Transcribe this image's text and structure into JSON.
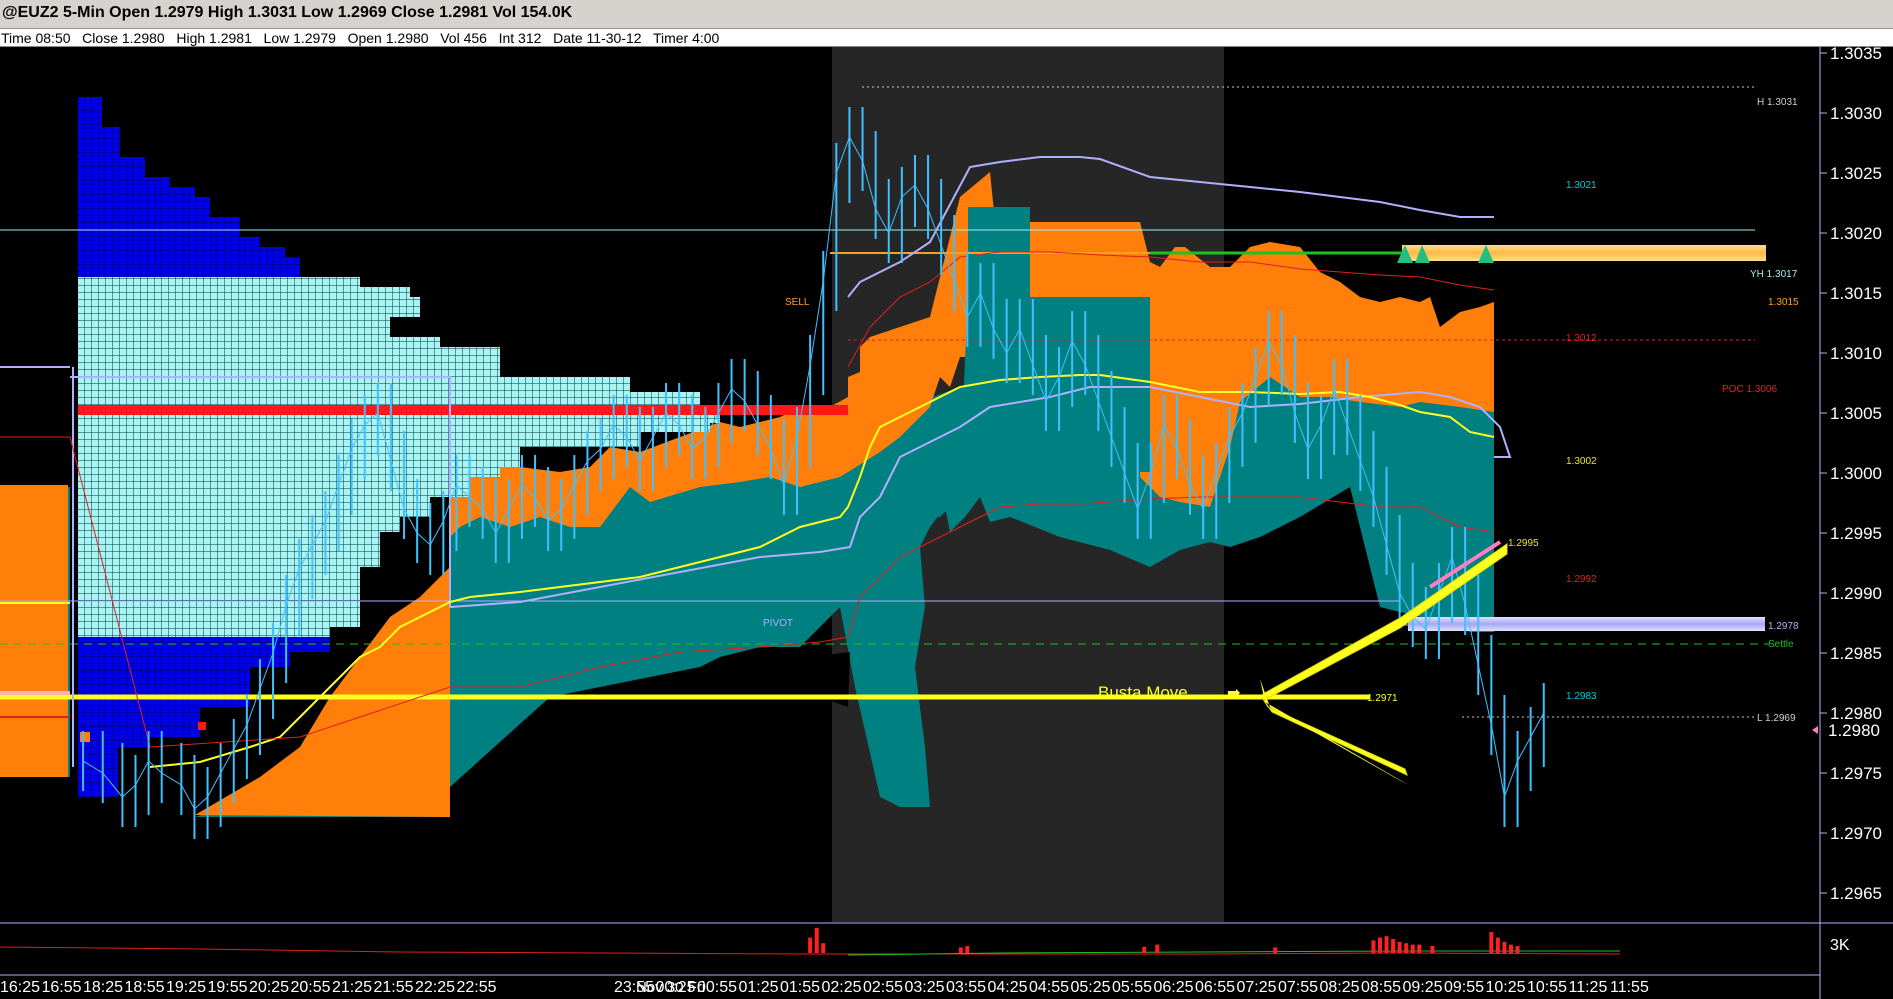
{
  "header": {
    "title": "@EUZ2 5-Min Open 1.2979 High 1.3031 Low 1.2969 Close 1.2981 Vol 154.0K",
    "info": "Time 08:50   Close 1.2980   High 1.2981   Low 1.2979   Open 1.2980   Vol 456   Int 312   Date 11-30-12   Timer 4:00"
  },
  "chart_data": {
    "type": "line",
    "symbol": "@EUZ2",
    "interval": "5-Min",
    "ylim": [
      1.29625,
      1.30355
    ],
    "y_ticks": [
      "1.3035",
      "1.3030",
      "1.3025",
      "1.3020",
      "1.3015",
      "1.3010",
      "1.3005",
      "1.3000",
      "1.2995",
      "1.2990",
      "1.2985",
      "1.2980",
      "1.2975",
      "1.2970",
      "1.2965"
    ],
    "current_price": "1.2980",
    "volume_scale_label": "3K",
    "x_time_labels": [
      "16:25",
      "16:55",
      "18:25",
      "18:55",
      "19:25",
      "19:55",
      "20:25",
      "20:55",
      "21:25",
      "21:55",
      "22:25",
      "22:55",
      "23:55",
      "00:25",
      "00:55",
      "01:25",
      "01:55",
      "02:25",
      "02:55",
      "03:25",
      "03:55",
      "04:25",
      "04:55",
      "05:25",
      "05:55",
      "06:25",
      "06:55",
      "07:25",
      "07:55",
      "08:25",
      "08:55",
      "09:25",
      "09:55",
      "10:25",
      "10:55",
      "11:25",
      "11:55"
    ],
    "date_label": "Nov 30 Fri",
    "levels": [
      {
        "label": "H 1.3031",
        "value": 1.3031
      },
      {
        "label": "YH 1.3017",
        "value": 1.3017
      },
      {
        "label": "1.3015",
        "value": 1.3015,
        "tag": "SELL"
      },
      {
        "label": "POC 1.3006",
        "value": 1.3006
      },
      {
        "label": "PIVOT",
        "value": 1.2978,
        "price_label": "1.2978"
      },
      {
        "label": "Settle",
        "value": 1.29765
      },
      {
        "label": "1.2971",
        "value": 1.2971
      },
      {
        "label": "L 1.2969",
        "value": 1.2969
      }
    ],
    "series_labels": [
      {
        "text": "1.3021",
        "value": 1.3021,
        "color": "#00d0d0"
      },
      {
        "text": "1.3012",
        "value": 1.3012,
        "color": "#e02020"
      },
      {
        "text": "1.3002",
        "value": 1.3002,
        "color": "#e8e820"
      },
      {
        "text": "1.2992",
        "value": 1.2992,
        "color": "#e02020"
      },
      {
        "text": "1.2983",
        "value": 1.2983,
        "color": "#00d0d0"
      },
      {
        "text": "1.2995",
        "value": 1.2995,
        "color": "#e8e820"
      }
    ],
    "annotation": "Busta Move",
    "price_path": [
      [
        2,
        1.2976
      ],
      [
        5,
        1.2975
      ],
      [
        8,
        1.2973
      ],
      [
        10,
        1.2974
      ],
      [
        12,
        1.2976
      ],
      [
        14,
        1.2975
      ],
      [
        17,
        1.2974
      ],
      [
        19,
        1.2972
      ],
      [
        21,
        1.2973
      ],
      [
        23,
        1.2975
      ],
      [
        25,
        1.2977
      ],
      [
        27,
        1.2979
      ],
      [
        29,
        1.2982
      ],
      [
        31,
        1.2985
      ],
      [
        33,
        1.2989
      ],
      [
        35,
        1.2992
      ],
      [
        37,
        1.2994
      ],
      [
        39,
        1.2996
      ],
      [
        41,
        1.2999
      ],
      [
        43,
        1.3002
      ],
      [
        45,
        1.3004
      ],
      [
        47,
        1.3005
      ],
      [
        49,
        1.3001
      ],
      [
        51,
        1.2997
      ],
      [
        53,
        1.2995
      ],
      [
        55,
        1.2994
      ],
      [
        57,
        1.2996
      ],
      [
        59,
        1.2999
      ],
      [
        61,
        1.2998
      ],
      [
        63,
        1.2997
      ],
      [
        65,
        1.2995
      ],
      [
        67,
        1.2997
      ],
      [
        69,
        1.2999
      ],
      [
        71,
        1.2998
      ],
      [
        73,
        1.2996
      ],
      [
        75,
        1.2997
      ],
      [
        77,
        1.2999
      ],
      [
        79,
        1.3001
      ],
      [
        81,
        1.3002
      ],
      [
        83,
        1.3004
      ],
      [
        85,
        1.3003
      ],
      [
        87,
        1.3001
      ],
      [
        89,
        1.3003
      ],
      [
        91,
        1.3005
      ],
      [
        93,
        1.3004
      ],
      [
        95,
        1.3002
      ],
      [
        97,
        1.3003
      ],
      [
        99,
        1.3005
      ],
      [
        101,
        1.3007
      ],
      [
        103,
        1.3006
      ],
      [
        105,
        1.3004
      ],
      [
        107,
        1.3002
      ],
      [
        109,
        1.2999
      ],
      [
        111,
        1.3003
      ],
      [
        113,
        1.3009
      ],
      [
        115,
        1.3016
      ],
      [
        117,
        1.3025
      ],
      [
        119,
        1.3028
      ],
      [
        121,
        1.3026
      ],
      [
        123,
        1.3022
      ],
      [
        125,
        1.302
      ],
      [
        127,
        1.3023
      ],
      [
        129,
        1.3024
      ],
      [
        131,
        1.3022
      ],
      [
        133,
        1.3019
      ],
      [
        135,
        1.3016
      ],
      [
        137,
        1.3013
      ],
      [
        139,
        1.3015
      ],
      [
        141,
        1.3012
      ],
      [
        143,
        1.301
      ],
      [
        145,
        1.3012
      ],
      [
        147,
        1.3009
      ],
      [
        149,
        1.3006
      ],
      [
        151,
        1.3008
      ],
      [
        153,
        1.3011
      ],
      [
        155,
        1.3009
      ],
      [
        157,
        1.3006
      ],
      [
        159,
        1.3003
      ],
      [
        161,
        1.3
      ],
      [
        163,
        1.2997
      ],
      [
        165,
        1.3
      ],
      [
        167,
        1.3004
      ],
      [
        169,
        1.3002
      ],
      [
        171,
        1.2999
      ],
      [
        173,
        1.2997
      ],
      [
        175,
        1.3
      ],
      [
        177,
        1.3003
      ],
      [
        179,
        1.3005
      ],
      [
        181,
        1.3008
      ],
      [
        183,
        1.3011
      ],
      [
        185,
        1.3009
      ],
      [
        187,
        1.3005
      ],
      [
        189,
        1.3002
      ],
      [
        191,
        1.3004
      ],
      [
        193,
        1.3007
      ],
      [
        195,
        1.3004
      ],
      [
        197,
        1.3001
      ],
      [
        199,
        1.2998
      ],
      [
        201,
        1.2994
      ],
      [
        203,
        1.299
      ],
      [
        205,
        1.2988
      ],
      [
        207,
        1.2987
      ],
      [
        209,
        1.299
      ],
      [
        211,
        1.2993
      ],
      [
        213,
        1.2989
      ],
      [
        215,
        1.2984
      ],
      [
        217,
        1.2979
      ],
      [
        219,
        1.2973
      ],
      [
        221,
        1.2976
      ],
      [
        223,
        1.2978
      ],
      [
        225,
        1.298
      ]
    ],
    "volume": [
      {
        "bar": 113,
        "value": 0.55
      },
      {
        "bar": 114,
        "value": 0.9
      },
      {
        "bar": 115,
        "value": 0.35
      },
      {
        "bar": 136,
        "value": 0.2
      },
      {
        "bar": 137,
        "value": 0.25
      },
      {
        "bar": 164,
        "value": 0.22
      },
      {
        "bar": 166,
        "value": 0.3
      },
      {
        "bar": 184,
        "value": 0.2
      },
      {
        "bar": 199,
        "value": 0.45
      },
      {
        "bar": 200,
        "value": 0.55
      },
      {
        "bar": 201,
        "value": 0.6
      },
      {
        "bar": 202,
        "value": 0.5
      },
      {
        "bar": 203,
        "value": 0.4
      },
      {
        "bar": 204,
        "value": 0.35
      },
      {
        "bar": 205,
        "value": 0.3
      },
      {
        "bar": 206,
        "value": 0.3
      },
      {
        "bar": 208,
        "value": 0.25
      },
      {
        "bar": 217,
        "value": 0.75
      },
      {
        "bar": 218,
        "value": 0.55
      },
      {
        "bar": 219,
        "value": 0.4
      },
      {
        "bar": 220,
        "value": 0.3
      },
      {
        "bar": 221,
        "value": 0.25
      }
    ]
  }
}
